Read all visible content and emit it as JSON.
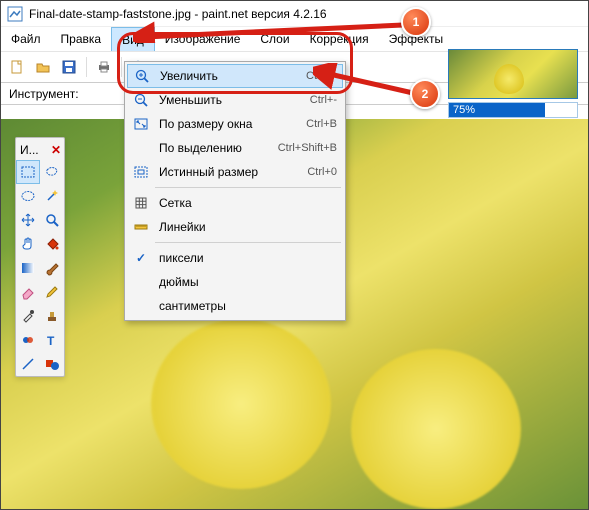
{
  "window": {
    "title": "Final-date-stamp-faststone.jpg - paint.net версия 4.2.16"
  },
  "menubar": {
    "items": [
      {
        "label": "Файл"
      },
      {
        "label": "Правка"
      },
      {
        "label": "Вид"
      },
      {
        "label": "Изображение"
      },
      {
        "label": "Слои"
      },
      {
        "label": "Коррекция"
      },
      {
        "label": "Эффекты"
      }
    ]
  },
  "instrument_row": {
    "label": "Инструмент:"
  },
  "progress": {
    "percent": "75%",
    "value": 75
  },
  "toolpal": {
    "header": "И...",
    "close": "✕"
  },
  "dropdown": {
    "items": [
      {
        "label": "Увеличить",
        "shortcut": "Ctrl++",
        "icon": "zoom-in"
      },
      {
        "label": "Уменьшить",
        "shortcut": "Ctrl+-",
        "icon": "zoom-out"
      },
      {
        "label": "По размеру окна",
        "shortcut": "Ctrl+B",
        "icon": "fit-window"
      },
      {
        "label": "По выделению",
        "shortcut": "Ctrl+Shift+B",
        "icon": ""
      },
      {
        "label": "Истинный размер",
        "shortcut": "Ctrl+0",
        "icon": "actual-size"
      }
    ],
    "items2": [
      {
        "label": "Сетка",
        "icon": "grid"
      },
      {
        "label": "Линейки",
        "icon": "ruler"
      }
    ],
    "items3": [
      {
        "label": "пиксели",
        "checked": true
      },
      {
        "label": "дюймы",
        "checked": false
      },
      {
        "label": "сантиметры",
        "checked": false
      }
    ]
  },
  "annotations": {
    "one": "1",
    "two": "2"
  }
}
